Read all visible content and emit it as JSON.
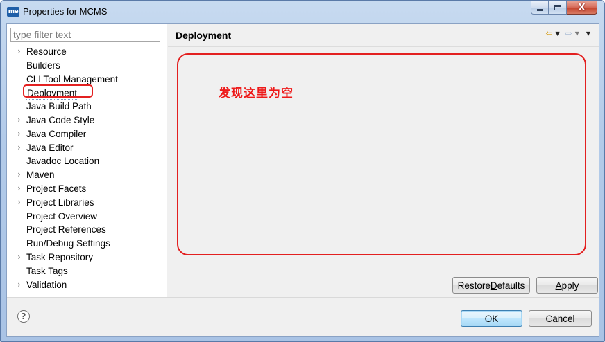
{
  "window": {
    "title": "Properties for MCMS",
    "app_icon_text": "me",
    "close_glyph": "X"
  },
  "filter": {
    "placeholder": "type filter text"
  },
  "tree": {
    "items": [
      {
        "label": "Resource",
        "expandable": true
      },
      {
        "label": "Builders",
        "expandable": false
      },
      {
        "label": "CLI Tool Management",
        "expandable": false
      },
      {
        "label": "Deployment",
        "expandable": false,
        "selected": true
      },
      {
        "label": "Java Build Path",
        "expandable": false
      },
      {
        "label": "Java Code Style",
        "expandable": true
      },
      {
        "label": "Java Compiler",
        "expandable": true
      },
      {
        "label": "Java Editor",
        "expandable": true
      },
      {
        "label": "Javadoc Location",
        "expandable": false
      },
      {
        "label": "Maven",
        "expandable": true
      },
      {
        "label": "Project Facets",
        "expandable": true
      },
      {
        "label": "Project Libraries",
        "expandable": true
      },
      {
        "label": "Project Overview",
        "expandable": false
      },
      {
        "label": "Project References",
        "expandable": false
      },
      {
        "label": "Run/Debug Settings",
        "expandable": false
      },
      {
        "label": "Task Repository",
        "expandable": true
      },
      {
        "label": "Task Tags",
        "expandable": false
      },
      {
        "label": "Validation",
        "expandable": true
      }
    ],
    "arrow_glyph": "›"
  },
  "page": {
    "title": "Deployment",
    "annotation": "发现这里为空"
  },
  "nav": {
    "back_glyph": "⇦",
    "forward_glyph": "⇨",
    "dropdown_glyph": "▼"
  },
  "buttons": {
    "restore_pre": "Restore ",
    "restore_mnemonic": "D",
    "restore_post": "efaults",
    "apply_mnemonic": "A",
    "apply_post": "pply",
    "ok": "OK",
    "cancel": "Cancel",
    "help_glyph": "?"
  },
  "colors": {
    "annotation_red": "#e32020",
    "window_frame": "#b3cbe9",
    "dialog_bg": "#f0f0f0"
  }
}
